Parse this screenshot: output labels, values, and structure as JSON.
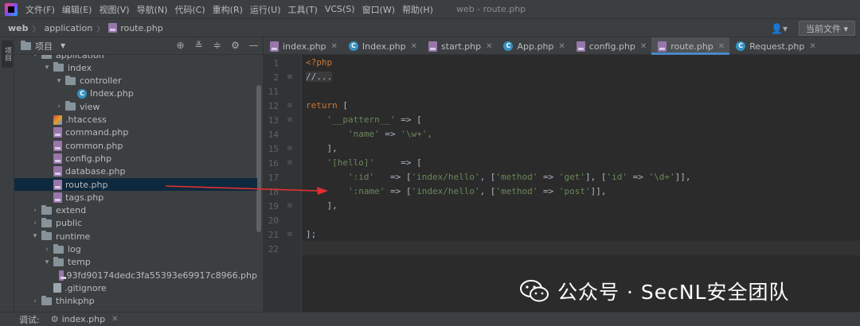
{
  "menubar": {
    "items": [
      "文件(F)",
      "编辑(E)",
      "视图(V)",
      "导航(N)",
      "代码(C)",
      "重构(R)",
      "运行(U)",
      "工具(T)",
      "VCS(S)",
      "窗口(W)",
      "帮助(H)"
    ],
    "window_title": "web - route.php"
  },
  "navbar": {
    "crumbs": [
      "web",
      "application",
      "route.php"
    ],
    "user_icon": "person-icon",
    "run_config": "当前文件"
  },
  "toolstrip": {
    "label": "项目"
  },
  "project_panel": {
    "title": "项目",
    "tools": [
      "target-icon",
      "collapse-all-icon",
      "expand-icon",
      "gear-icon",
      "minimize-icon"
    ],
    "tree": [
      {
        "label": "application",
        "kind": "folder",
        "depth": 1,
        "expanded": true
      },
      {
        "label": "index",
        "kind": "folder",
        "depth": 2,
        "expanded": true
      },
      {
        "label": "controller",
        "kind": "folder",
        "depth": 3,
        "expanded": true
      },
      {
        "label": "Index.php",
        "kind": "class",
        "depth": 4
      },
      {
        "label": "view",
        "kind": "folder",
        "depth": 3,
        "expanded": false
      },
      {
        "label": ".htaccess",
        "kind": "htaccess",
        "depth": 2
      },
      {
        "label": "command.php",
        "kind": "php",
        "depth": 2
      },
      {
        "label": "common.php",
        "kind": "php",
        "depth": 2
      },
      {
        "label": "config.php",
        "kind": "php",
        "depth": 2
      },
      {
        "label": "database.php",
        "kind": "php",
        "depth": 2
      },
      {
        "label": "route.php",
        "kind": "php",
        "depth": 2,
        "selected": true
      },
      {
        "label": "tags.php",
        "kind": "php",
        "depth": 2
      },
      {
        "label": "extend",
        "kind": "folder",
        "depth": 1,
        "expanded": false
      },
      {
        "label": "public",
        "kind": "folder",
        "depth": 1,
        "expanded": false
      },
      {
        "label": "runtime",
        "kind": "folder",
        "depth": 1,
        "expanded": true
      },
      {
        "label": "log",
        "kind": "folder",
        "depth": 2,
        "expanded": false
      },
      {
        "label": "temp",
        "kind": "folder",
        "depth": 2,
        "expanded": true
      },
      {
        "label": "93fd90174dedc3fa55393e69917c8966.php",
        "kind": "php",
        "depth": 3
      },
      {
        "label": ".gitignore",
        "kind": "generic",
        "depth": 2
      },
      {
        "label": "thinkphp",
        "kind": "folder",
        "depth": 1,
        "expanded": false
      }
    ]
  },
  "editor": {
    "tabs": [
      {
        "label": "index.php",
        "kind": "php",
        "active": false
      },
      {
        "label": "Index.php",
        "kind": "class",
        "active": false
      },
      {
        "label": "start.php",
        "kind": "php",
        "active": false
      },
      {
        "label": "App.php",
        "kind": "class",
        "active": false
      },
      {
        "label": "config.php",
        "kind": "php",
        "active": false
      },
      {
        "label": "route.php",
        "kind": "php",
        "active": true
      },
      {
        "label": "Request.php",
        "kind": "class",
        "active": false
      }
    ],
    "gutter": [
      {
        "num": "1",
        "fold": ""
      },
      {
        "num": "2",
        "fold": "⊞"
      },
      {
        "num": "11",
        "fold": ""
      },
      {
        "num": "12",
        "fold": "⊟"
      },
      {
        "num": "13",
        "fold": "⊟"
      },
      {
        "num": "14",
        "fold": ""
      },
      {
        "num": "15",
        "fold": "⊟"
      },
      {
        "num": "16",
        "fold": "⊟"
      },
      {
        "num": "17",
        "fold": ""
      },
      {
        "num": "18",
        "fold": ""
      },
      {
        "num": "19",
        "fold": "⊟"
      },
      {
        "num": "20",
        "fold": ""
      },
      {
        "num": "21",
        "fold": "⊟"
      },
      {
        "num": "22",
        "fold": ""
      }
    ],
    "code": [
      [
        {
          "t": "<?php",
          "c": "phptag"
        }
      ],
      [
        {
          "t": "//...",
          "c": "folded"
        }
      ],
      [],
      [
        {
          "t": "return",
          "c": "kw"
        },
        {
          "t": " [",
          "c": "ph"
        }
      ],
      [
        {
          "t": "    ",
          "c": "ph"
        },
        {
          "t": "'__pattern__'",
          "c": "str"
        },
        {
          "t": " => [",
          "c": "ph"
        }
      ],
      [
        {
          "t": "        ",
          "c": "ph"
        },
        {
          "t": "'name'",
          "c": "str"
        },
        {
          "t": " => ",
          "c": "ph"
        },
        {
          "t": "'\\w+'",
          "c": "str"
        },
        {
          "t": ",",
          "c": "kw"
        }
      ],
      [
        {
          "t": "    ],",
          "c": "ph"
        }
      ],
      [
        {
          "t": "    ",
          "c": "ph"
        },
        {
          "t": "'[hello]'",
          "c": "str"
        },
        {
          "t": "     => [",
          "c": "ph"
        }
      ],
      [
        {
          "t": "        ",
          "c": "ph"
        },
        {
          "t": "':id'",
          "c": "str"
        },
        {
          "t": "   => [",
          "c": "ph"
        },
        {
          "t": "'index/hello'",
          "c": "str"
        },
        {
          "t": ", [",
          "c": "ph"
        },
        {
          "t": "'method'",
          "c": "str"
        },
        {
          "t": " => ",
          "c": "ph"
        },
        {
          "t": "'get'",
          "c": "str"
        },
        {
          "t": "], [",
          "c": "ph"
        },
        {
          "t": "'id'",
          "c": "str"
        },
        {
          "t": " => ",
          "c": "ph"
        },
        {
          "t": "'\\d+'",
          "c": "str"
        },
        {
          "t": "]],",
          "c": "ph"
        }
      ],
      [
        {
          "t": "        ",
          "c": "ph"
        },
        {
          "t": "':name'",
          "c": "str"
        },
        {
          "t": " => [",
          "c": "ph"
        },
        {
          "t": "'index/hello'",
          "c": "str"
        },
        {
          "t": ", [",
          "c": "ph"
        },
        {
          "t": "'method'",
          "c": "str"
        },
        {
          "t": " => ",
          "c": "ph"
        },
        {
          "t": "'post'",
          "c": "str"
        },
        {
          "t": "]],",
          "c": "ph"
        }
      ],
      [
        {
          "t": "    ],",
          "c": "ph"
        }
      ],
      [],
      [
        {
          "t": "];",
          "c": "ph"
        }
      ],
      []
    ]
  },
  "watermark": {
    "text": "公众号 · SecNL安全团队",
    "icon": "wechat-icon"
  },
  "bottombar": {
    "label": "调试:",
    "tab": "index.php",
    "tab_icon": "gear-icon"
  },
  "colors": {
    "selection": "#0d293e",
    "accent": "#4a88c7",
    "arrow": "#e03030"
  }
}
